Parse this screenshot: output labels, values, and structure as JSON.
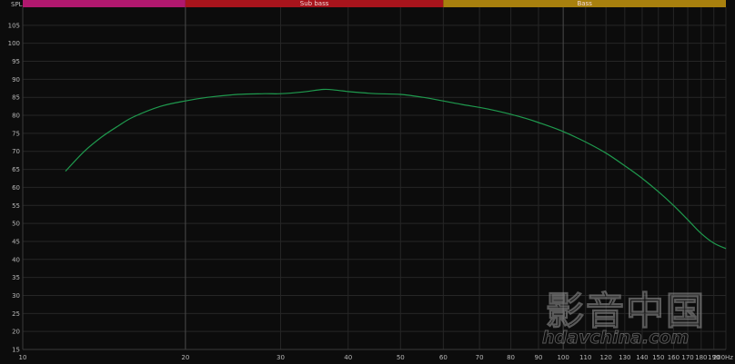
{
  "chart_data": {
    "type": "line",
    "title": "",
    "ylabel": "SPL",
    "xlabel": "",
    "x_scale": "log",
    "xlim": [
      10,
      200
    ],
    "ylim": [
      15,
      110
    ],
    "grid": true,
    "y_ticks": [
      15,
      20,
      25,
      30,
      35,
      40,
      45,
      50,
      55,
      60,
      65,
      70,
      75,
      80,
      85,
      90,
      95,
      100,
      105
    ],
    "x_ticks": [
      {
        "value": 10,
        "label": "10"
      },
      {
        "value": 20,
        "label": "20"
      },
      {
        "value": 30,
        "label": "30"
      },
      {
        "value": 40,
        "label": "40"
      },
      {
        "value": 50,
        "label": "50"
      },
      {
        "value": 60,
        "label": "60"
      },
      {
        "value": 70,
        "label": "70"
      },
      {
        "value": 80,
        "label": "80"
      },
      {
        "value": 90,
        "label": "90"
      },
      {
        "value": 100,
        "label": "100"
      },
      {
        "value": 110,
        "label": "110"
      },
      {
        "value": 120,
        "label": "120"
      },
      {
        "value": 130,
        "label": "130"
      },
      {
        "value": 140,
        "label": "140"
      },
      {
        "value": 150,
        "label": "150"
      },
      {
        "value": 160,
        "label": "160"
      },
      {
        "value": 170,
        "label": "170"
      },
      {
        "value": 180,
        "label": "180"
      },
      {
        "value": 190,
        "label": "190"
      },
      {
        "value": 200,
        "label": "200Hz"
      }
    ],
    "bands": [
      {
        "label": "",
        "from": 10,
        "to": 20,
        "color": "#b0186e"
      },
      {
        "label": "Sub bass",
        "from": 20,
        "to": 60,
        "color": "#a8141c"
      },
      {
        "label": "Bass",
        "from": 60,
        "to": 200,
        "color": "#a8800e"
      }
    ],
    "series": [
      {
        "color": "#1f9a4e",
        "x": [
          12,
          13,
          14,
          15,
          16,
          18,
          20,
          22,
          25,
          28,
          30,
          33,
          36,
          38,
          40,
          43,
          45,
          50,
          55,
          60,
          65,
          70,
          75,
          80,
          85,
          90,
          100,
          110,
          120,
          130,
          140,
          150,
          160,
          170,
          180,
          190,
          200
        ],
        "y": [
          64.5,
          70,
          74,
          77,
          79.5,
          82.5,
          84,
          85,
          85.8,
          86,
          86,
          86.5,
          87.2,
          87,
          86.6,
          86.2,
          86,
          85.8,
          85,
          84,
          83,
          82.2,
          81.3,
          80.3,
          79.2,
          78,
          75.5,
          72.6,
          69.5,
          66,
          62.5,
          58.8,
          55,
          51,
          47.2,
          44.5,
          43
        ]
      }
    ]
  },
  "watermark": {
    "text": "hdavchina.com",
    "logo_text": "影音中国"
  }
}
